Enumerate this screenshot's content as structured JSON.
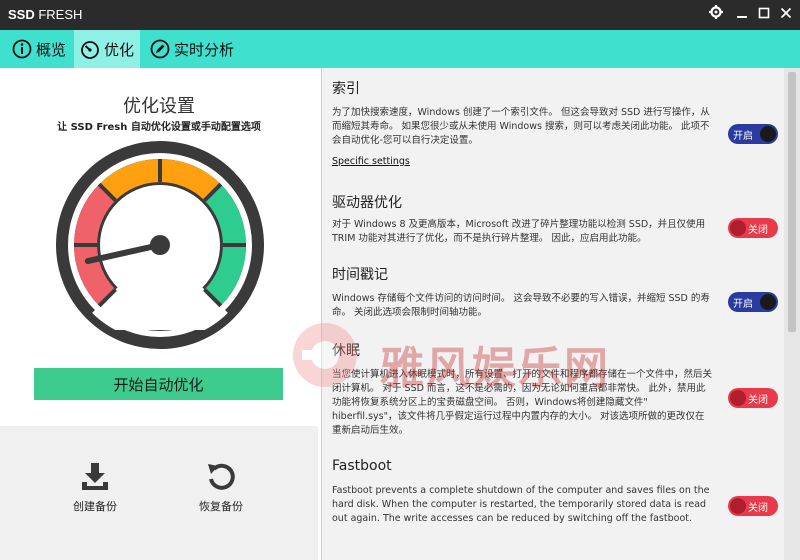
{
  "window": {
    "title_bold": "SSD",
    "title_rest": " FRESH"
  },
  "tabs": [
    {
      "label": "概览",
      "icon": "info-icon"
    },
    {
      "label": "优化",
      "icon": "speedometer-icon",
      "active": true
    },
    {
      "label": "实时分析",
      "icon": "pencil-circle-icon"
    }
  ],
  "optimize": {
    "title": "优化设置",
    "subtitle": "让 SSD Fresh 自动优化设置或手动配置选项",
    "start_button": "开始自动优化",
    "gauge_level_percent": 12
  },
  "actions": [
    {
      "label": "创建备份",
      "icon": "download-tray-icon"
    },
    {
      "label": "恢复备份",
      "icon": "undo-circular-icon"
    }
  ],
  "sections": [
    {
      "heading": "索引",
      "desc": "为了加快搜索速度，Windows 创建了一个索引文件。 但这会导致对 SSD 进行写操作，从而缩短其寿命。 如果您很少或从未使用 Windows 搜索，则可以考虑关闭此功能。 此项不会自动优化-您可以自行决定设置。",
      "link": "Specific settings",
      "toggle": "开启",
      "state": "on"
    },
    {
      "heading": "驱动器优化",
      "desc": "对于 Windows 8 及更高版本，Microsoft 改进了碎片整理功能以检测 SSD，并且仅使用 TRIM 功能对其进行了优化，而不是执行碎片整理。 因此，应启用此功能。",
      "toggle": "关闭",
      "state": "off"
    },
    {
      "heading": "时间戳记",
      "desc": "Windows 存储每个文件访问的访问时间。 这会导致不必要的写入错误，并缩短 SSD 的寿命。 关闭此选项会限制时间轴功能。",
      "toggle": "开启",
      "state": "on"
    },
    {
      "heading": "休眠",
      "desc": "当您使计算机进入休眠模式时，所有设置、打开的文件和程序都存储在一个文件中，然后关闭计算机。 对于 SSD 而言，这不是必需的，因为无论如何重启都非常快。 此外，禁用此功能将恢复系统分区上的宝贵磁盘空间。 否则，Windows将创建隐藏文件\" hiberfil.sys\"，该文件将几乎假定运行过程中内置内存的大小。 对该选项所做的更改仅在重新启动后生效。",
      "toggle": "关闭",
      "state": "off"
    },
    {
      "heading": "Fastboot",
      "desc": "Fastboot prevents a complete shutdown of the computer and saves files on the hard disk. When the computer is restarted, the temporarily stored data is read out again. The write accesses can be reduced by switching off the fastboot.",
      "toggle": "关闭",
      "state": "off"
    }
  ],
  "watermark": {
    "text": "雅风娱乐网"
  },
  "colors": {
    "tabbar": "#40e0cf",
    "tab_active": "#8ff0e5",
    "start_button": "#3dcc8e",
    "toggle_on": "#2a3aa0",
    "toggle_off": "#e83a4a"
  }
}
